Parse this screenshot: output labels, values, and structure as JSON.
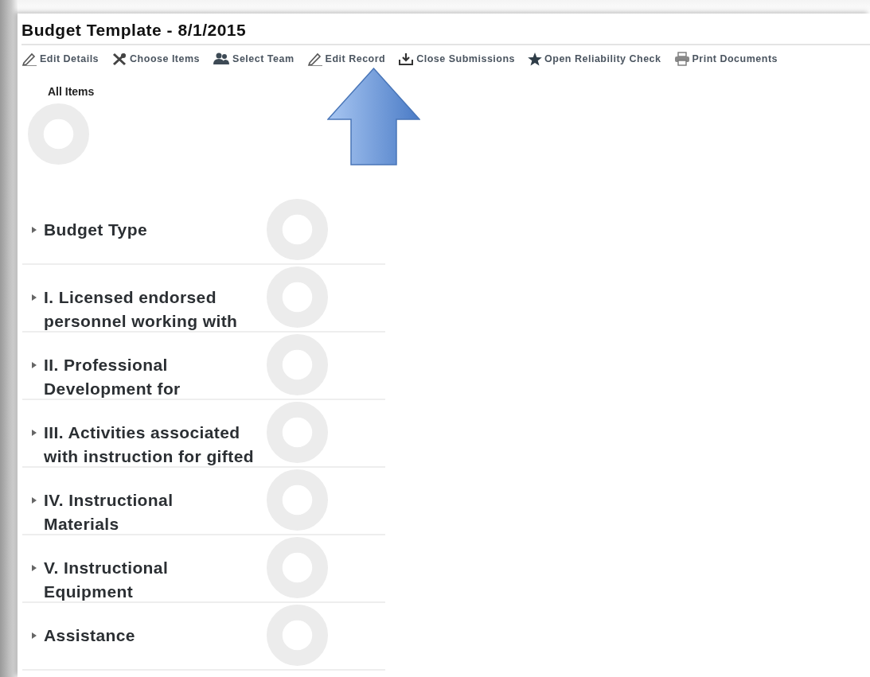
{
  "window": {
    "title": "Budget Template - 8/1/2015"
  },
  "toolbar": [
    {
      "label": "Edit Details",
      "kind": "pencil"
    },
    {
      "label": "Choose Items",
      "kind": "tools"
    },
    {
      "label": "Select Team",
      "kind": "team"
    },
    {
      "label": "Edit Record",
      "kind": "pencil"
    },
    {
      "label": "Close Submissions",
      "kind": "download"
    },
    {
      "label": "Open Reliability Check",
      "kind": "star"
    },
    {
      "label": "Print Documents",
      "kind": "printer"
    }
  ],
  "all_items": {
    "label": "All Items"
  },
  "items": [
    {
      "lines": [
        "Budget Type"
      ]
    },
    {
      "lines": [
        "I. Licensed endorsed",
        "personnel working with"
      ]
    },
    {
      "lines": [
        "II. Professional",
        "Development for"
      ]
    },
    {
      "lines": [
        "III. Activities associated",
        "with instruction for gifted"
      ]
    },
    {
      "lines": [
        "IV. Instructional",
        "Materials"
      ]
    },
    {
      "lines": [
        "V. Instructional",
        "Equipment"
      ]
    },
    {
      "lines": [
        "Assistance"
      ]
    }
  ]
}
